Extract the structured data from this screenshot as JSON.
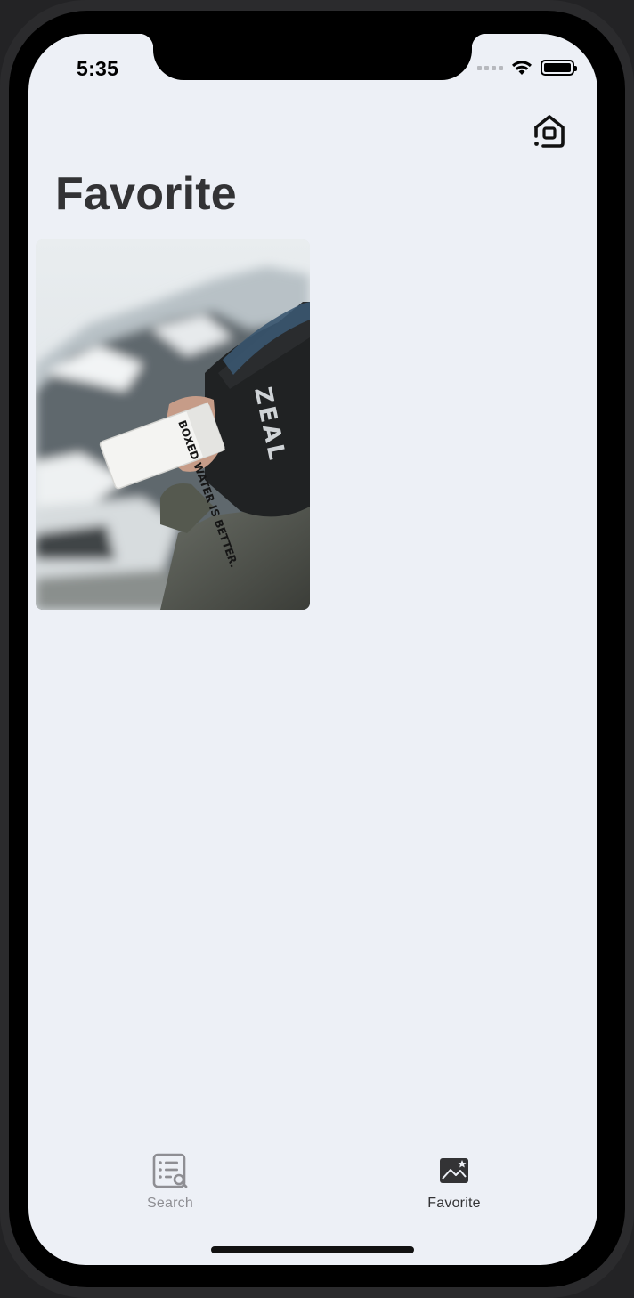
{
  "status_bar": {
    "time": "5:35"
  },
  "header": {
    "title": "Favorite",
    "home_icon": "home-settings-icon"
  },
  "favorites": {
    "items": [
      {
        "image_description_icon": "photo",
        "text_on_carton": "BOXED WATER IS BETTER.",
        "text_on_goggle_strap": "ZEAL"
      }
    ]
  },
  "tabbar": {
    "tabs": [
      {
        "label": "Search",
        "icon": "list-search-icon",
        "selected": false
      },
      {
        "label": "Favorite",
        "icon": "photo-star-icon",
        "selected": true
      }
    ]
  },
  "colors": {
    "background": "#edf0f6",
    "title": "#333335",
    "tab_inactive": "#8e8e93",
    "tab_active": "#333335"
  }
}
